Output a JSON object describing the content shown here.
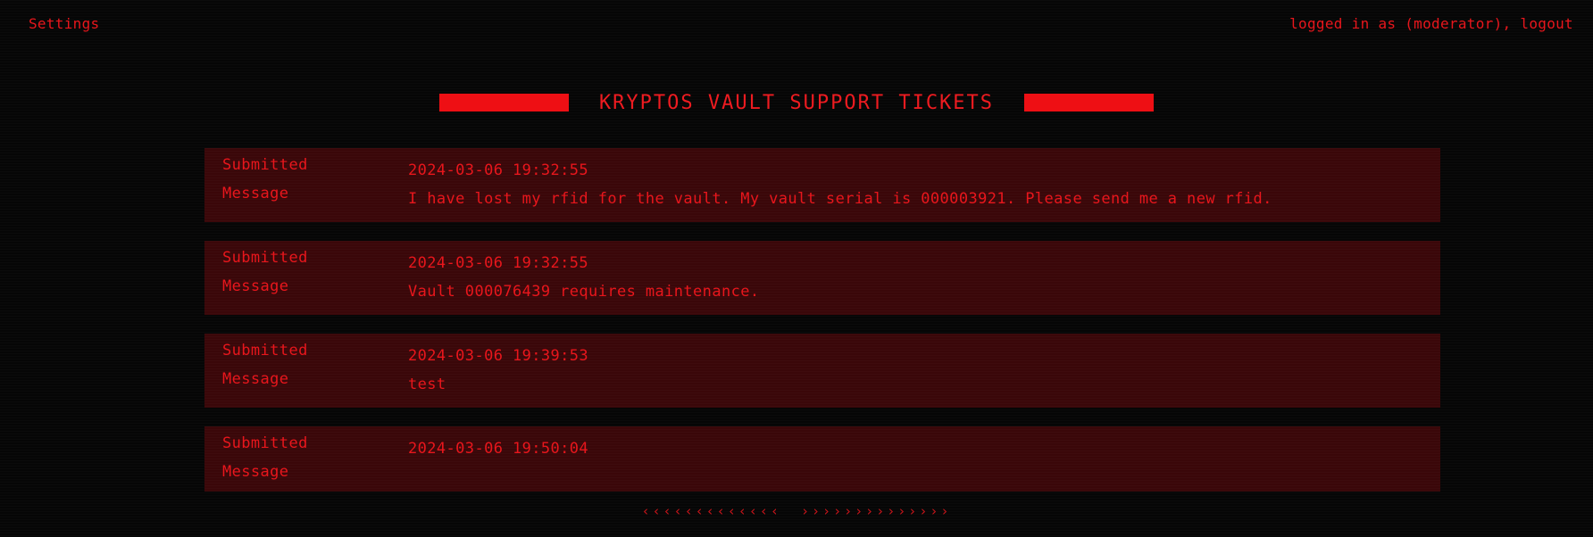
{
  "header": {
    "settings_label": "Settings",
    "user_status_prefix": "logged in as (moderator), ",
    "logout_label": "logout"
  },
  "page": {
    "title": "KRYPTOS VAULT SUPPORT TICKETS"
  },
  "field_labels": {
    "submitted": "Submitted",
    "message": "Message"
  },
  "tickets": [
    {
      "submitted": "2024-03-06 19:32:55",
      "message": "I have lost my rfid for the vault. My vault serial is 000003921. Please send me a new rfid."
    },
    {
      "submitted": "2024-03-06 19:32:55",
      "message": "Vault 000076439 requires maintenance."
    },
    {
      "submitted": "2024-03-06 19:39:53",
      "message": "test"
    },
    {
      "submitted": "2024-03-06 19:50:04",
      "message": ""
    }
  ],
  "pagination": {
    "prev_label": "‹‹‹‹‹‹‹‹‹‹‹‹‹",
    "next_label": "››››››››››››››"
  },
  "colors": {
    "accent": "#e8161c",
    "background": "#060606",
    "ticket_background": "#3a0709"
  }
}
